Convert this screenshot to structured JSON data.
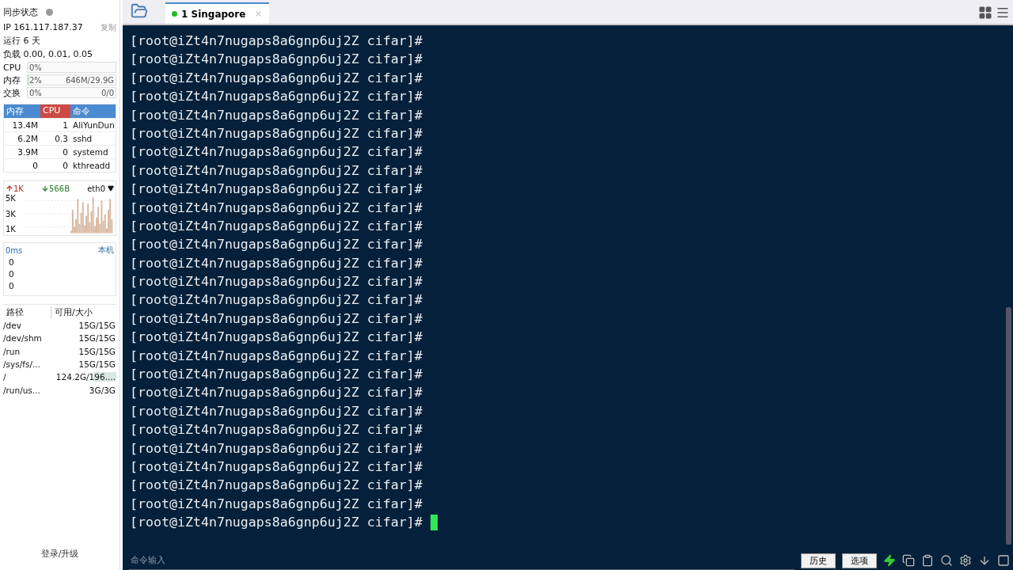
{
  "sidebar": {
    "sync_status": {
      "label": "同步状态",
      "online": false
    },
    "ip": "IP 161.117.187.37",
    "copy_button": "复制",
    "uptime": "运行 6 天",
    "load": "负载 0.00, 0.01, 0.05",
    "meters": [
      {
        "label": "CPU",
        "percent": "0%"
      },
      {
        "label": "内存",
        "percent": "2%",
        "reading": "646M/29.9G",
        "level": 0.02
      },
      {
        "label": "交换",
        "percent": "0%",
        "reading": "0/0"
      }
    ],
    "processes": {
      "columns": [
        {
          "label": "内存",
          "selected": false
        },
        {
          "label": "CPU",
          "selected": true
        },
        {
          "label": "命令",
          "selected": false
        }
      ],
      "rows": [
        [
          "13.4M",
          "1",
          "AliYunDun"
        ],
        [
          "6.2M",
          "0.3",
          "sshd"
        ],
        [
          "3.9M",
          "0",
          "systemd"
        ],
        [
          "0",
          "0",
          "kthreadd"
        ]
      ]
    },
    "network": {
      "up": "1K",
      "down": "566B",
      "interface": "eth0",
      "scale": [
        "5K",
        "3K",
        "1K"
      ]
    },
    "ping": {
      "latency": "0ms",
      "host": "本机",
      "values": [
        "0",
        "0",
        "0"
      ]
    },
    "disks": {
      "columns": [
        "路径",
        "可用/大小"
      ],
      "rows": [
        {
          "path": "/dev",
          "size": "15G/15G"
        },
        {
          "path": "/dev/shm",
          "size": "15G/15G"
        },
        {
          "path": "/run",
          "size": "15G/15G"
        },
        {
          "path": "/sys/fs/...",
          "size": "15G/15G"
        },
        {
          "path": "/",
          "size": "124.2G/196....",
          "level": 0.37
        },
        {
          "path": "/run/us...",
          "size": "3G/3G"
        }
      ]
    },
    "login_button": "登录/升级"
  },
  "tabs": [
    {
      "label": "1 Singapore",
      "selected": true,
      "connected": true
    }
  ],
  "terminal": {
    "lines": [
      {
        "text": "[root@iZt4n7nugaps8a6gnp6uj2Z cifar]#",
        "cursor": false
      },
      {
        "text": "[root@iZt4n7nugaps8a6gnp6uj2Z cifar]#",
        "cursor": false
      },
      {
        "text": "[root@iZt4n7nugaps8a6gnp6uj2Z cifar]#",
        "cursor": false
      },
      {
        "text": "[root@iZt4n7nugaps8a6gnp6uj2Z cifar]#",
        "cursor": false
      },
      {
        "text": "[root@iZt4n7nugaps8a6gnp6uj2Z cifar]#",
        "cursor": false
      },
      {
        "text": "[root@iZt4n7nugaps8a6gnp6uj2Z cifar]#",
        "cursor": false
      },
      {
        "text": "[root@iZt4n7nugaps8a6gnp6uj2Z cifar]#",
        "cursor": false
      },
      {
        "text": "[root@iZt4n7nugaps8a6gnp6uj2Z cifar]#",
        "cursor": false
      },
      {
        "text": "[root@iZt4n7nugaps8a6gnp6uj2Z cifar]#",
        "cursor": false
      },
      {
        "text": "[root@iZt4n7nugaps8a6gnp6uj2Z cifar]#",
        "cursor": false
      },
      {
        "text": "[root@iZt4n7nugaps8a6gnp6uj2Z cifar]#",
        "cursor": false
      },
      {
        "text": "[root@iZt4n7nugaps8a6gnp6uj2Z cifar]#",
        "cursor": false
      },
      {
        "text": "[root@iZt4n7nugaps8a6gnp6uj2Z cifar]#",
        "cursor": false
      },
      {
        "text": "[root@iZt4n7nugaps8a6gnp6uj2Z cifar]#",
        "cursor": false
      },
      {
        "text": "[root@iZt4n7nugaps8a6gnp6uj2Z cifar]#",
        "cursor": false
      },
      {
        "text": "[root@iZt4n7nugaps8a6gnp6uj2Z cifar]#",
        "cursor": false
      },
      {
        "text": "[root@iZt4n7nugaps8a6gnp6uj2Z cifar]#",
        "cursor": false
      },
      {
        "text": "[root@iZt4n7nugaps8a6gnp6uj2Z cifar]#",
        "cursor": false
      },
      {
        "text": "[root@iZt4n7nugaps8a6gnp6uj2Z cifar]#",
        "cursor": false
      },
      {
        "text": "[root@iZt4n7nugaps8a6gnp6uj2Z cifar]#",
        "cursor": false
      },
      {
        "text": "[root@iZt4n7nugaps8a6gnp6uj2Z cifar]#",
        "cursor": false
      },
      {
        "text": "[root@iZt4n7nugaps8a6gnp6uj2Z cifar]#",
        "cursor": false
      },
      {
        "text": "[root@iZt4n7nugaps8a6gnp6uj2Z cifar]#",
        "cursor": false
      },
      {
        "text": "[root@iZt4n7nugaps8a6gnp6uj2Z cifar]#",
        "cursor": false
      },
      {
        "text": "[root@iZt4n7nugaps8a6gnp6uj2Z cifar]#",
        "cursor": false
      },
      {
        "text": "[root@iZt4n7nugaps8a6gnp6uj2Z cifar]#",
        "cursor": false
      },
      {
        "text": "[root@iZt4n7nugaps8a6gnp6uj2Z cifar]#",
        "cursor": true
      }
    ]
  },
  "command_bar": {
    "placeholder": "命令输入",
    "buttons": [
      "历史",
      "选项"
    ]
  }
}
